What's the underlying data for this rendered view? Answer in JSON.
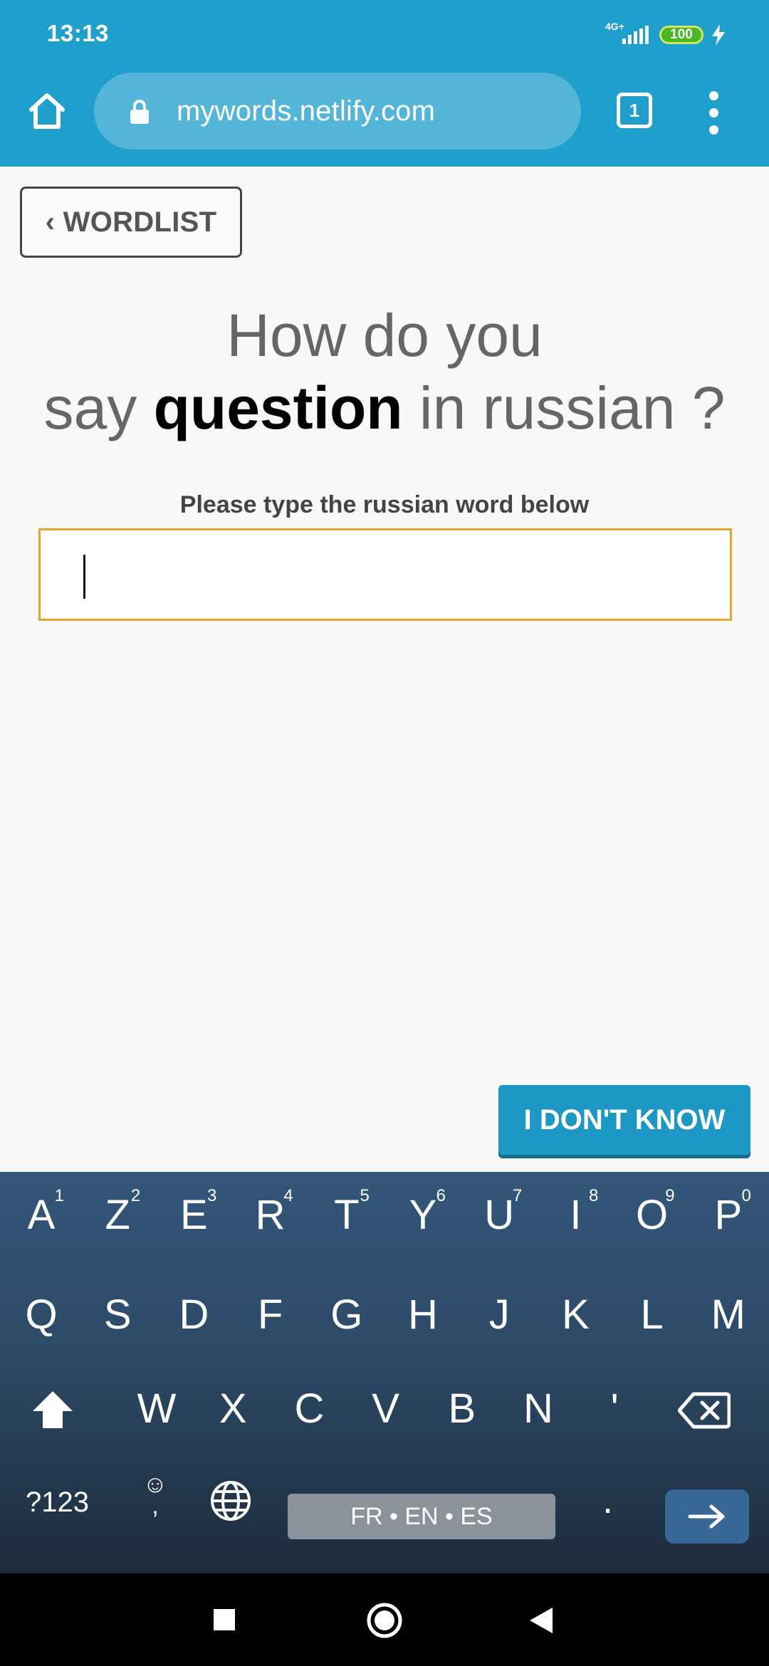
{
  "status_bar": {
    "time": "13:13",
    "network": "4G+",
    "battery": "100"
  },
  "browser": {
    "url": "mywords.netlify.com",
    "tab_count": "1",
    "icons": [
      "home-icon",
      "lock-icon",
      "tabs-icon",
      "more-vert-icon"
    ]
  },
  "page": {
    "back_button": "‹ WORDLIST",
    "question": {
      "line1": "How do you",
      "prefix": "say ",
      "word": "question",
      "suffix": " in russian ?"
    },
    "instruction": "Please type the russian word below",
    "answer_value": "",
    "dont_know_button": "I DON'T KNOW"
  },
  "keyboard": {
    "row1": [
      {
        "key": "A",
        "hint": "1"
      },
      {
        "key": "Z",
        "hint": "2"
      },
      {
        "key": "E",
        "hint": "3"
      },
      {
        "key": "R",
        "hint": "4"
      },
      {
        "key": "T",
        "hint": "5"
      },
      {
        "key": "Y",
        "hint": "6"
      },
      {
        "key": "U",
        "hint": "7"
      },
      {
        "key": "I",
        "hint": "8"
      },
      {
        "key": "O",
        "hint": "9"
      },
      {
        "key": "P",
        "hint": "0"
      }
    ],
    "row2": [
      "Q",
      "S",
      "D",
      "F",
      "G",
      "H",
      "J",
      "K",
      "L",
      "M"
    ],
    "row3": [
      "W",
      "X",
      "C",
      "V",
      "B",
      "N",
      "'"
    ],
    "symbols": "?123",
    "emoji_comma": ",",
    "space_label": "FR • EN • ES",
    "period": ".",
    "icons": [
      "shift-icon",
      "backspace-icon",
      "emoji-icon",
      "globe-icon",
      "enter-arrow-icon"
    ]
  },
  "nav": {
    "icons": [
      "recent-apps-icon",
      "home-circle-icon",
      "back-triangle-icon"
    ]
  }
}
